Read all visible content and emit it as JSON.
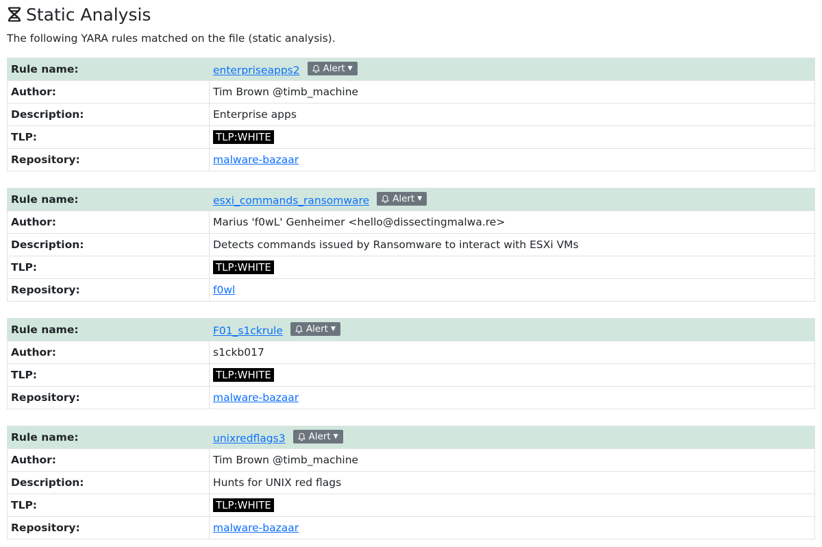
{
  "header": {
    "title": "Static Analysis",
    "icon": "dna-icon",
    "subtitle": "The following YARA rules matched on the file (static analysis)."
  },
  "labels": {
    "rule_name": "Rule name:",
    "author": "Author:",
    "description": "Description:",
    "tlp": "TLP:",
    "repository": "Repository:",
    "alert": "Alert"
  },
  "rules": [
    {
      "name": "enterpriseapps2",
      "author": "Tim Brown @timb_machine",
      "description": "Enterprise apps",
      "tlp": "TLP:WHITE",
      "repository": "malware-bazaar"
    },
    {
      "name": "esxi_commands_ransomware",
      "author": "Marius 'f0wL' Genheimer <hello@dissectingmalwa.re>",
      "description": "Detects commands issued by Ransomware to interact with ESXi VMs",
      "tlp": "TLP:WHITE",
      "repository": "f0wl"
    },
    {
      "name": "F01_s1ckrule",
      "author": "s1ckb017",
      "tlp": "TLP:WHITE",
      "repository": "malware-bazaar"
    },
    {
      "name": "unixredflags3",
      "author": "Tim Brown @timb_machine",
      "description": "Hunts for UNIX red flags",
      "tlp": "TLP:WHITE",
      "repository": "malware-bazaar"
    }
  ],
  "colors": {
    "header_row": "#d1e7dd",
    "link": "#0d6efd",
    "alert_button": "#6c757d",
    "tlp_badge": "#000000"
  }
}
